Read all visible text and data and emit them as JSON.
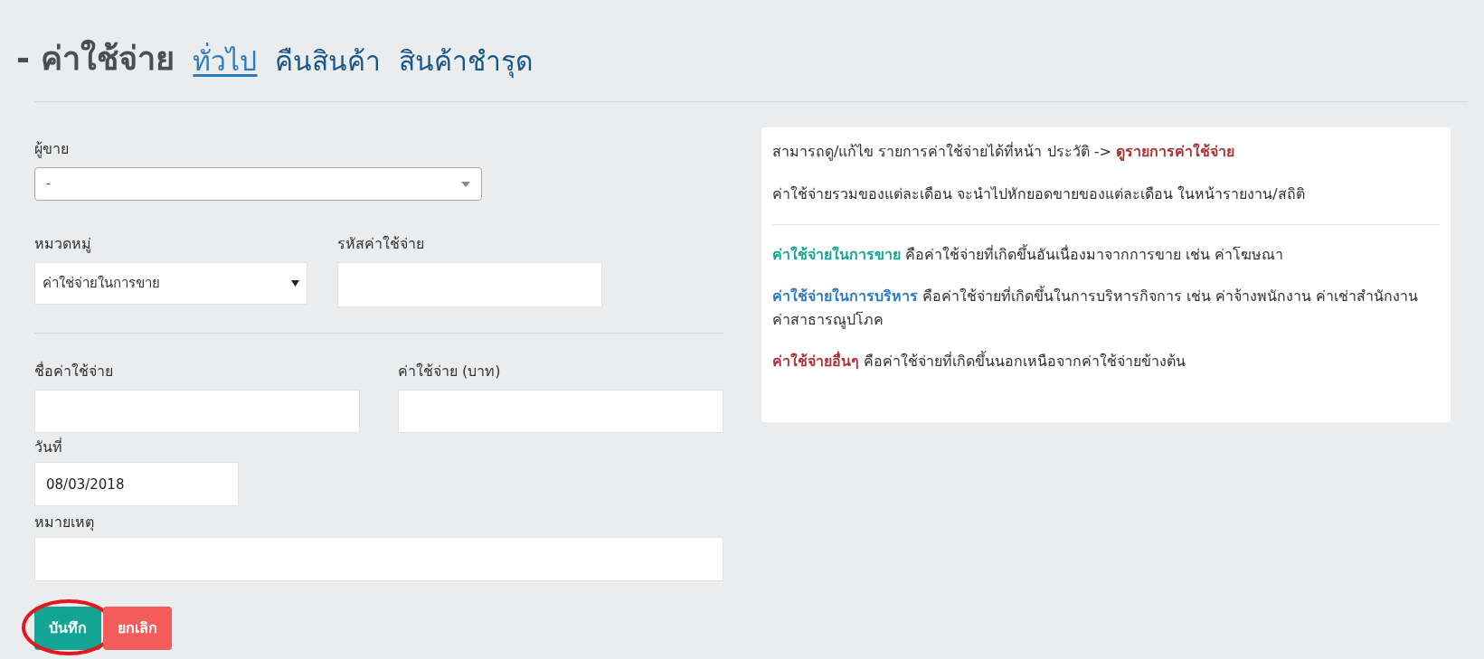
{
  "header": {
    "title": "- ค่าใช้จ่าย",
    "tabs": [
      {
        "label": "ทั่วไป",
        "selected": true
      },
      {
        "label": "คืนสินค้า",
        "selected": false
      },
      {
        "label": "สินค้าชำรุด",
        "selected": false
      }
    ]
  },
  "form": {
    "vendor": {
      "label": "ผู้ขาย",
      "value": "-"
    },
    "category": {
      "label": "หมวดหมู่",
      "value": "ค่าใช่จ่ายในการขาย"
    },
    "code": {
      "label": "รหัสค่าใช้จ่าย"
    },
    "name": {
      "label": "ชื่อค่าใช้จ่าย"
    },
    "amount": {
      "label": "ค่าใช้จ่าย (บาท)"
    },
    "date": {
      "label": "วันที่",
      "value": "08/03/2018"
    },
    "note": {
      "label": "หมายเหตุ"
    },
    "buttons": [
      {
        "kind": "save",
        "label": "บันทึก",
        "circled": true
      },
      {
        "kind": "cancel",
        "label": "ยกเลิก",
        "circled": false
      }
    ]
  },
  "info": {
    "history": {
      "text": "สามารถดู/แก้ไข รายการค่าใช้จ่ายได้ที่หน้า ประวัติ ->",
      "link": "ดูรายการค่าใช้จ่าย"
    },
    "monthly": "ค่าใช้จ่ายรวมของแต่ละเดือน จะนำไปหักยอดขายของแต่ละเดือน ในหน้ารายงาน/สถิติ",
    "definitions": [
      {
        "term": "ค่าใช้จ่ายในการขาย",
        "text": "คือค่าใช้จ่ายที่เกิดขึ้นอันเนื่องมาจากการขาย เช่น ค่าโฆษณา",
        "color": "#13a596"
      },
      {
        "term": "ค่าใช้จ่ายในการบริหาร",
        "text": "คือค่าใช้จ่ายที่เกิดขึ้นในการบริหารกิจการ เช่น ค่าจ้างพนักงาน ค่าเช่าสำนักงาน ค่าสาธารณูปโภค",
        "color": "#2c7bbf"
      },
      {
        "term": "ค่าใช้จ่ายอื่นๆ",
        "text": "คือค่าใช้จ่ายที่เกิดขึ้นนอกเหนือจากค่าใช้จ่ายข้างต้น",
        "color": "#a93339"
      }
    ]
  }
}
